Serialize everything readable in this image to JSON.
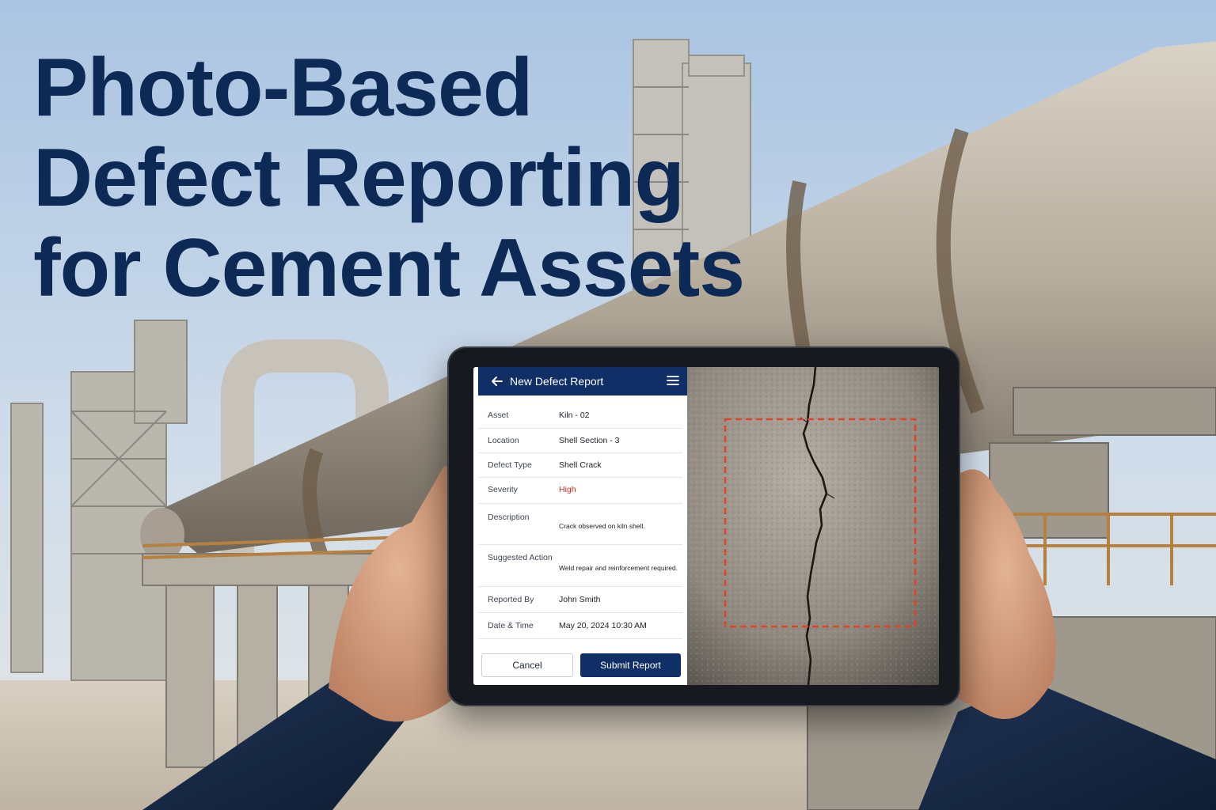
{
  "headline": {
    "line1": "Photo-Based",
    "line2": "Defect Reporting",
    "line3": "for Cement Assets"
  },
  "app": {
    "title": "New Defect Report",
    "back_icon": "arrow-left-icon",
    "menu_icon": "hamburger-menu-icon"
  },
  "form": {
    "fields": [
      {
        "label": "Asset",
        "value": "Kiln - 02"
      },
      {
        "label": "Location",
        "value": "Shell Section - 3"
      },
      {
        "label": "Defect Type",
        "value": "Shell Crack"
      },
      {
        "label": "Severity",
        "value": "High"
      },
      {
        "label": "Description",
        "value": "Crack observed on kiln shell."
      },
      {
        "label": "Suggested Action",
        "value": "Weld repair and reinforcement required."
      },
      {
        "label": "Reported By",
        "value": "John Smith"
      },
      {
        "label": "Date & Time",
        "value": "May 20, 2024 10:30 AM"
      }
    ]
  },
  "actions": {
    "cancel_label": "Cancel",
    "submit_label": "Submit Report"
  },
  "colors": {
    "brand": "#0f2f66",
    "headline": "#0d2a57",
    "severity_high": "#c8321f",
    "selection_box": "#e0432c"
  }
}
